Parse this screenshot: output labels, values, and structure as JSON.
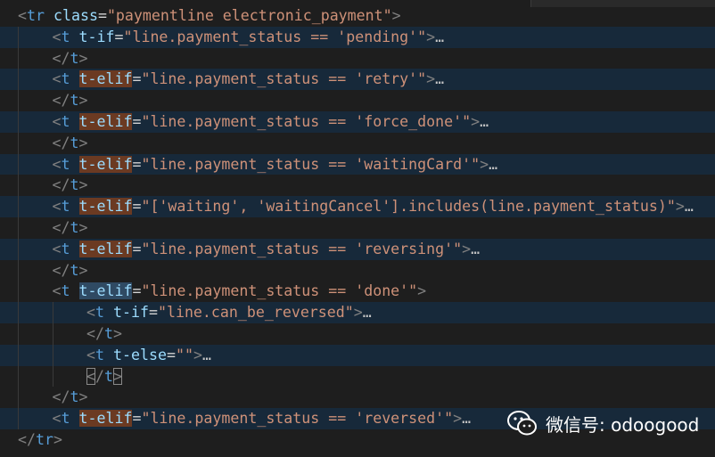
{
  "watermark": {
    "icon": "wechat-icon",
    "text": "微信号: odoogood"
  },
  "code_lines": [
    {
      "indent": 0,
      "hl": false,
      "tokens": [
        {
          "t": "<",
          "c": "lt"
        },
        {
          "t": "tr",
          "c": "tag"
        },
        {
          "t": " ",
          "c": "eq"
        },
        {
          "t": "class",
          "c": "attr"
        },
        {
          "t": "=",
          "c": "eq"
        },
        {
          "t": "\"paymentline electronic_payment\"",
          "c": "str"
        },
        {
          "t": ">",
          "c": "gt"
        }
      ]
    },
    {
      "indent": 1,
      "hl": true,
      "tokens": [
        {
          "t": "<",
          "c": "lt"
        },
        {
          "t": "t",
          "c": "tag"
        },
        {
          "t": " ",
          "c": "eq"
        },
        {
          "t": "t-if",
          "c": "attr"
        },
        {
          "t": "=",
          "c": "eq"
        },
        {
          "t": "\"line.payment_status == 'pending'\"",
          "c": "str"
        },
        {
          "t": ">",
          "c": "gt"
        },
        {
          "t": "…",
          "c": "fold"
        }
      ]
    },
    {
      "indent": 1,
      "hl": false,
      "tokens": [
        {
          "t": "</",
          "c": "lt"
        },
        {
          "t": "t",
          "c": "tag"
        },
        {
          "t": ">",
          "c": "gt"
        }
      ]
    },
    {
      "indent": 1,
      "hl": true,
      "tokens": [
        {
          "t": "<",
          "c": "lt"
        },
        {
          "t": "t",
          "c": "tag"
        },
        {
          "t": " ",
          "c": "eq"
        },
        {
          "t": "t-elif",
          "c": "attr elif"
        },
        {
          "t": "=",
          "c": "eq"
        },
        {
          "t": "\"line.payment_status == 'retry'\"",
          "c": "str"
        },
        {
          "t": ">",
          "c": "gt"
        },
        {
          "t": "…",
          "c": "fold"
        }
      ]
    },
    {
      "indent": 1,
      "hl": false,
      "tokens": [
        {
          "t": "</",
          "c": "lt"
        },
        {
          "t": "t",
          "c": "tag"
        },
        {
          "t": ">",
          "c": "gt"
        }
      ]
    },
    {
      "indent": 1,
      "hl": true,
      "tokens": [
        {
          "t": "<",
          "c": "lt"
        },
        {
          "t": "t",
          "c": "tag"
        },
        {
          "t": " ",
          "c": "eq"
        },
        {
          "t": "t-elif",
          "c": "attr elif"
        },
        {
          "t": "=",
          "c": "eq"
        },
        {
          "t": "\"line.payment_status == 'force_done'\"",
          "c": "str"
        },
        {
          "t": ">",
          "c": "gt"
        },
        {
          "t": "…",
          "c": "fold"
        }
      ]
    },
    {
      "indent": 1,
      "hl": false,
      "tokens": [
        {
          "t": "</",
          "c": "lt"
        },
        {
          "t": "t",
          "c": "tag"
        },
        {
          "t": ">",
          "c": "gt"
        }
      ]
    },
    {
      "indent": 1,
      "hl": true,
      "tokens": [
        {
          "t": "<",
          "c": "lt"
        },
        {
          "t": "t",
          "c": "tag"
        },
        {
          "t": " ",
          "c": "eq"
        },
        {
          "t": "t-elif",
          "c": "attr elif"
        },
        {
          "t": "=",
          "c": "eq"
        },
        {
          "t": "\"line.payment_status == 'waitingCard'\"",
          "c": "str"
        },
        {
          "t": ">",
          "c": "gt"
        },
        {
          "t": "…",
          "c": "fold"
        }
      ]
    },
    {
      "indent": 1,
      "hl": false,
      "tokens": [
        {
          "t": "</",
          "c": "lt"
        },
        {
          "t": "t",
          "c": "tag"
        },
        {
          "t": ">",
          "c": "gt"
        }
      ]
    },
    {
      "indent": 1,
      "hl": true,
      "tokens": [
        {
          "t": "<",
          "c": "lt"
        },
        {
          "t": "t",
          "c": "tag"
        },
        {
          "t": " ",
          "c": "eq"
        },
        {
          "t": "t-elif",
          "c": "attr elif"
        },
        {
          "t": "=",
          "c": "eq"
        },
        {
          "t": "\"['waiting', 'waitingCancel'].includes(line.payment_status)\"",
          "c": "str"
        },
        {
          "t": ">",
          "c": "gt"
        },
        {
          "t": "…",
          "c": "fold"
        }
      ]
    },
    {
      "indent": 1,
      "hl": false,
      "tokens": [
        {
          "t": "</",
          "c": "lt"
        },
        {
          "t": "t",
          "c": "tag"
        },
        {
          "t": ">",
          "c": "gt"
        }
      ]
    },
    {
      "indent": 1,
      "hl": true,
      "tokens": [
        {
          "t": "<",
          "c": "lt"
        },
        {
          "t": "t",
          "c": "tag"
        },
        {
          "t": " ",
          "c": "eq"
        },
        {
          "t": "t-elif",
          "c": "attr elif"
        },
        {
          "t": "=",
          "c": "eq"
        },
        {
          "t": "\"line.payment_status == 'reversing'\"",
          "c": "str"
        },
        {
          "t": ">",
          "c": "gt"
        },
        {
          "t": "…",
          "c": "fold"
        }
      ]
    },
    {
      "indent": 1,
      "hl": false,
      "tokens": [
        {
          "t": "</",
          "c": "lt"
        },
        {
          "t": "t",
          "c": "tag"
        },
        {
          "t": ">",
          "c": "gt"
        }
      ]
    },
    {
      "indent": 1,
      "hl": false,
      "tokens": [
        {
          "t": "<",
          "c": "lt"
        },
        {
          "t": "t",
          "c": "tag"
        },
        {
          "t": " ",
          "c": "eq"
        },
        {
          "t": "t-elif",
          "c": "attr elif sel"
        },
        {
          "t": "=",
          "c": "eq"
        },
        {
          "t": "\"line.payment_status == 'done'\"",
          "c": "str"
        },
        {
          "t": ">",
          "c": "gt"
        }
      ]
    },
    {
      "indent": 2,
      "hl": true,
      "tokens": [
        {
          "t": "<",
          "c": "lt"
        },
        {
          "t": "t",
          "c": "tag"
        },
        {
          "t": " ",
          "c": "eq"
        },
        {
          "t": "t-if",
          "c": "attr"
        },
        {
          "t": "=",
          "c": "eq"
        },
        {
          "t": "\"line.can_be_reversed\"",
          "c": "str"
        },
        {
          "t": ">",
          "c": "gt"
        },
        {
          "t": "…",
          "c": "fold"
        }
      ]
    },
    {
      "indent": 2,
      "hl": false,
      "tokens": [
        {
          "t": "</",
          "c": "lt"
        },
        {
          "t": "t",
          "c": "tag"
        },
        {
          "t": ">",
          "c": "gt"
        }
      ]
    },
    {
      "indent": 2,
      "hl": true,
      "tokens": [
        {
          "t": "<",
          "c": "lt"
        },
        {
          "t": "t",
          "c": "tag"
        },
        {
          "t": " ",
          "c": "eq"
        },
        {
          "t": "t-else",
          "c": "attr"
        },
        {
          "t": "=",
          "c": "eq"
        },
        {
          "t": "\"\"",
          "c": "str"
        },
        {
          "t": ">",
          "c": "gt"
        },
        {
          "t": "…",
          "c": "fold"
        }
      ]
    },
    {
      "indent": 2,
      "hl": false,
      "tokens": [
        {
          "t": "<",
          "c": "lt bracket"
        },
        {
          "t": "/",
          "c": "sl"
        },
        {
          "t": "t",
          "c": "tag"
        },
        {
          "t": ">",
          "c": "gt bracket"
        }
      ]
    },
    {
      "indent": 1,
      "hl": false,
      "tokens": [
        {
          "t": "</",
          "c": "lt"
        },
        {
          "t": "t",
          "c": "tag"
        },
        {
          "t": ">",
          "c": "gt"
        }
      ]
    },
    {
      "indent": 1,
      "hl": true,
      "tokens": [
        {
          "t": "<",
          "c": "lt"
        },
        {
          "t": "t",
          "c": "tag"
        },
        {
          "t": " ",
          "c": "eq"
        },
        {
          "t": "t-elif",
          "c": "attr elif"
        },
        {
          "t": "=",
          "c": "eq"
        },
        {
          "t": "\"line.payment_status == 'reversed'\"",
          "c": "str"
        },
        {
          "t": ">",
          "c": "gt"
        },
        {
          "t": "…",
          "c": "fold"
        }
      ]
    },
    {
      "indent": 0,
      "hl": false,
      "tokens": [
        {
          "t": "</",
          "c": "lt"
        },
        {
          "t": "tr",
          "c": "tag"
        },
        {
          "t": ">",
          "c": "gt"
        }
      ]
    }
  ]
}
